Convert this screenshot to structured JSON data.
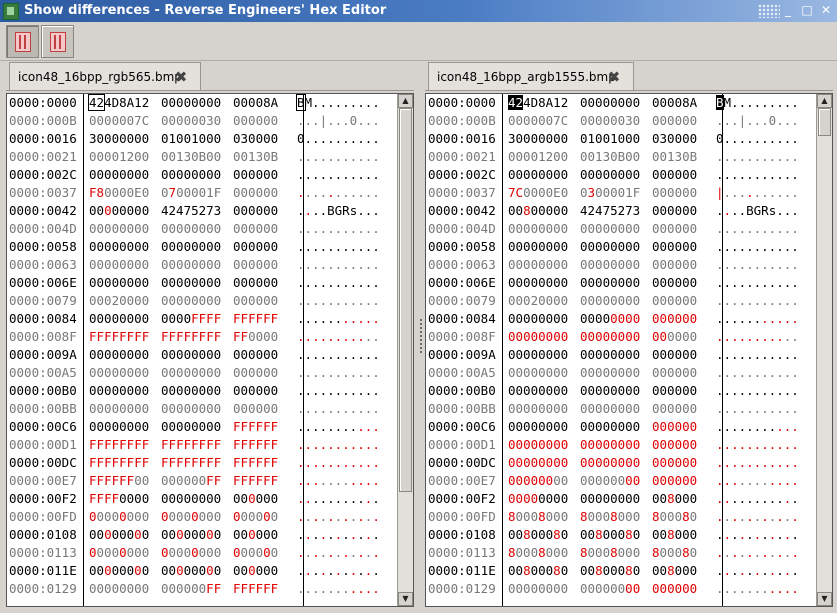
{
  "window": {
    "title": "Show differences - Reverse Engineers' Hex Editor",
    "buttons": {
      "minimize": "_",
      "maximize": "□",
      "close": "✕"
    }
  },
  "toolbar": {
    "buttons": [
      {
        "name": "diff-view-button-1",
        "icon": "columns-icon",
        "pressed": true
      },
      {
        "name": "diff-view-button-2",
        "icon": "columns-icon",
        "pressed": false
      }
    ]
  },
  "left": {
    "tab_label": "icon48_16bpp_rgb565.bmp",
    "rows": [
      {
        "off": "0000:0000",
        "h1": "424D8A12",
        "h2": "00000000",
        "h3": "00008A",
        "asc": "BM........."
      },
      {
        "off": "0000:000B",
        "h1": "0000007C",
        "h2": "00000030",
        "h3": "000000",
        "asc": "...|...0..."
      },
      {
        "off": "0000:0016",
        "h1": "30000000",
        "h2": "01001000",
        "h3": "030000",
        "asc": "0.........."
      },
      {
        "off": "0000:0021",
        "h1": "00001200",
        "h2": "00130B00",
        "h3": "00130B",
        "asc": "..........."
      },
      {
        "off": "0000:002C",
        "h1": "00000000",
        "h2": "00000000",
        "h3": "000000",
        "asc": "..........."
      },
      {
        "off": "0000:0037",
        "h1": "F80000E0",
        "h2": "0700001F",
        "h3": "000000",
        "asc": "..........."
      },
      {
        "off": "0000:0042",
        "h1": "00000000",
        "h2": "42475273",
        "h3": "000000",
        "asc": "....BGRs..."
      },
      {
        "off": "0000:004D",
        "h1": "00000000",
        "h2": "00000000",
        "h3": "000000",
        "asc": "..........."
      },
      {
        "off": "0000:0058",
        "h1": "00000000",
        "h2": "00000000",
        "h3": "000000",
        "asc": "..........."
      },
      {
        "off": "0000:0063",
        "h1": "00000000",
        "h2": "00000000",
        "h3": "000000",
        "asc": "..........."
      },
      {
        "off": "0000:006E",
        "h1": "00000000",
        "h2": "00000000",
        "h3": "000000",
        "asc": "..........."
      },
      {
        "off": "0000:0079",
        "h1": "00020000",
        "h2": "00000000",
        "h3": "000000",
        "asc": "..........."
      },
      {
        "off": "0000:0084",
        "h1": "00000000",
        "h2": "0000FFFF",
        "h3": "FFFFFF",
        "asc": "..........."
      },
      {
        "off": "0000:008F",
        "h1": "FFFFFFFF",
        "h2": "FFFFFFFF",
        "h3": "FF0000",
        "asc": "..........."
      },
      {
        "off": "0000:009A",
        "h1": "00000000",
        "h2": "00000000",
        "h3": "000000",
        "asc": "..........."
      },
      {
        "off": "0000:00A5",
        "h1": "00000000",
        "h2": "00000000",
        "h3": "000000",
        "asc": "..........."
      },
      {
        "off": "0000:00B0",
        "h1": "00000000",
        "h2": "00000000",
        "h3": "000000",
        "asc": "..........."
      },
      {
        "off": "0000:00BB",
        "h1": "00000000",
        "h2": "00000000",
        "h3": "000000",
        "asc": "..........."
      },
      {
        "off": "0000:00C6",
        "h1": "00000000",
        "h2": "00000000",
        "h3": "FFFFFF",
        "asc": "..........."
      },
      {
        "off": "0000:00D1",
        "h1": "FFFFFFFF",
        "h2": "FFFFFFFF",
        "h3": "FFFFFF",
        "asc": "..........."
      },
      {
        "off": "0000:00DC",
        "h1": "FFFFFFFF",
        "h2": "FFFFFFFF",
        "h3": "FFFFFF",
        "asc": "..........."
      },
      {
        "off": "0000:00E7",
        "h1": "FFFFFF00",
        "h2": "000000FF",
        "h3": "FFFFFF",
        "asc": "..........."
      },
      {
        "off": "0000:00F2",
        "h1": "FFFF0000",
        "h2": "00000000",
        "h3": "000000",
        "asc": "..........."
      },
      {
        "off": "0000:00FD",
        "h1": "00000000",
        "h2": "00000000",
        "h3": "000000",
        "asc": "..........."
      },
      {
        "off": "0000:0108",
        "h1": "00000000",
        "h2": "00000000",
        "h3": "000000",
        "asc": "..........."
      },
      {
        "off": "0000:0113",
        "h1": "00000000",
        "h2": "00000000",
        "h3": "000000",
        "asc": "..........."
      },
      {
        "off": "0000:011E",
        "h1": "00000000",
        "h2": "00000000",
        "h3": "000000",
        "asc": "..........."
      },
      {
        "off": "0000:0129",
        "h1": "00000000",
        "h2": "000000FF",
        "h3": "FFFFFF",
        "asc": "..........."
      }
    ]
  },
  "right": {
    "tab_label": "icon48_16bpp_argb1555.bmp",
    "rows": [
      {
        "off": "0000:0000",
        "h1": "424D8A12",
        "h2": "00000000",
        "h3": "00008A",
        "asc": "BM........."
      },
      {
        "off": "0000:000B",
        "h1": "0000007C",
        "h2": "00000030",
        "h3": "000000",
        "asc": "...|...0..."
      },
      {
        "off": "0000:0016",
        "h1": "30000000",
        "h2": "01001000",
        "h3": "030000",
        "asc": "0.........."
      },
      {
        "off": "0000:0021",
        "h1": "00001200",
        "h2": "00130B00",
        "h3": "00130B",
        "asc": "..........."
      },
      {
        "off": "0000:002C",
        "h1": "00000000",
        "h2": "00000000",
        "h3": "000000",
        "asc": "..........."
      },
      {
        "off": "0000:0037",
        "h1": "7C0000E0",
        "h2": "0300001F",
        "h3": "000000",
        "asc": "|.........."
      },
      {
        "off": "0000:0042",
        "h1": "00800000",
        "h2": "42475273",
        "h3": "000000",
        "asc": "....BGRs..."
      },
      {
        "off": "0000:004D",
        "h1": "00000000",
        "h2": "00000000",
        "h3": "000000",
        "asc": "..........."
      },
      {
        "off": "0000:0058",
        "h1": "00000000",
        "h2": "00000000",
        "h3": "000000",
        "asc": "..........."
      },
      {
        "off": "0000:0063",
        "h1": "00000000",
        "h2": "00000000",
        "h3": "000000",
        "asc": "..........."
      },
      {
        "off": "0000:006E",
        "h1": "00000000",
        "h2": "00000000",
        "h3": "000000",
        "asc": "..........."
      },
      {
        "off": "0000:0079",
        "h1": "00020000",
        "h2": "00000000",
        "h3": "000000",
        "asc": "..........."
      },
      {
        "off": "0000:0084",
        "h1": "00000000",
        "h2": "00000000",
        "h3": "000000",
        "asc": "..........."
      },
      {
        "off": "0000:008F",
        "h1": "00000000",
        "h2": "00000000",
        "h3": "000000",
        "asc": "..........."
      },
      {
        "off": "0000:009A",
        "h1": "00000000",
        "h2": "00000000",
        "h3": "000000",
        "asc": "..........."
      },
      {
        "off": "0000:00A5",
        "h1": "00000000",
        "h2": "00000000",
        "h3": "000000",
        "asc": "..........."
      },
      {
        "off": "0000:00B0",
        "h1": "00000000",
        "h2": "00000000",
        "h3": "000000",
        "asc": "..........."
      },
      {
        "off": "0000:00BB",
        "h1": "00000000",
        "h2": "00000000",
        "h3": "000000",
        "asc": "..........."
      },
      {
        "off": "0000:00C6",
        "h1": "00000000",
        "h2": "00000000",
        "h3": "000000",
        "asc": "..........."
      },
      {
        "off": "0000:00D1",
        "h1": "00000000",
        "h2": "00000000",
        "h3": "000000",
        "asc": "..........."
      },
      {
        "off": "0000:00DC",
        "h1": "00000000",
        "h2": "00000000",
        "h3": "000000",
        "asc": "..........."
      },
      {
        "off": "0000:00E7",
        "h1": "00000000",
        "h2": "00000000",
        "h3": "000000",
        "asc": "..........."
      },
      {
        "off": "0000:00F2",
        "h1": "00000000",
        "h2": "00000000",
        "h3": "008000",
        "asc": "..........."
      },
      {
        "off": "0000:00FD",
        "h1": "80008000",
        "h2": "80008000",
        "h3": "800080",
        "asc": "..........."
      },
      {
        "off": "0000:0108",
        "h1": "00800080",
        "h2": "00800080",
        "h3": "008000",
        "asc": "..........."
      },
      {
        "off": "0000:0113",
        "h1": "80008000",
        "h2": "80008000",
        "h3": "800080",
        "asc": "..........."
      },
      {
        "off": "0000:011E",
        "h1": "00800080",
        "h2": "00800080",
        "h3": "008000",
        "asc": "..........."
      },
      {
        "off": "0000:0129",
        "h1": "00000000",
        "h2": "00000000",
        "h3": "000000",
        "asc": "..........."
      }
    ]
  },
  "colors": {
    "diff": "#e00000",
    "title_bar": "#2c5aa0"
  }
}
